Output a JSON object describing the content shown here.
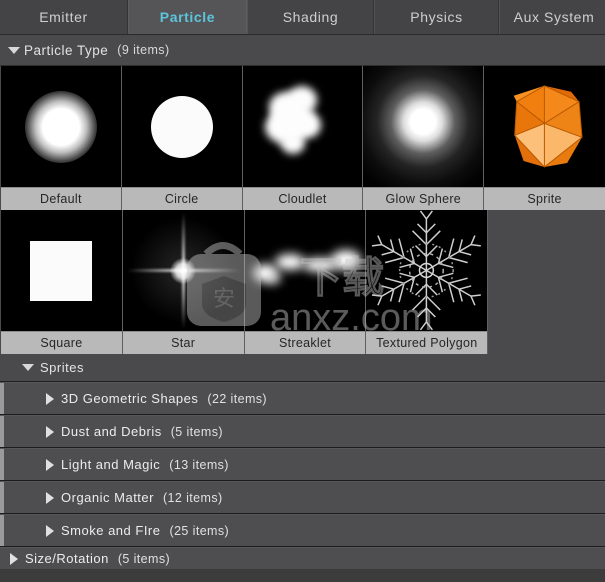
{
  "tabs": [
    {
      "label": "Emitter",
      "active": false
    },
    {
      "label": "Particle",
      "active": true
    },
    {
      "label": "Shading",
      "active": false
    },
    {
      "label": "Physics",
      "active": false
    },
    {
      "label": "Aux System",
      "active": false
    }
  ],
  "particle_type_section": {
    "title": "Particle Type",
    "count": "(9 items)",
    "expanded": true,
    "items": [
      {
        "label": "Default",
        "art": "soft-glow-dot"
      },
      {
        "label": "Circle",
        "art": "hard-circle"
      },
      {
        "label": "Cloudlet",
        "art": "cloud-blob"
      },
      {
        "label": "Glow Sphere",
        "art": "radial-glow"
      },
      {
        "label": "Sprite",
        "art": "orange-icosahedron"
      },
      {
        "label": "Square",
        "art": "white-square"
      },
      {
        "label": "Star",
        "art": "cross-flare-star"
      },
      {
        "label": "Streaklet",
        "art": "streak-blobs"
      },
      {
        "label": "Textured Polygon",
        "art": "snowflake-crystal"
      }
    ]
  },
  "sprites_section": {
    "title": "Sprites",
    "expanded": true,
    "rows": [
      {
        "label": "3D Geometric Shapes",
        "count": "(22 items)",
        "expanded": false
      },
      {
        "label": "Dust and Debris",
        "count": "(5 items)",
        "expanded": false
      },
      {
        "label": "Light and Magic",
        "count": "(13 items)",
        "expanded": false
      },
      {
        "label": "Organic Matter",
        "count": "(12 items)",
        "expanded": false
      },
      {
        "label": "Smoke and FIre",
        "count": "(25 items)",
        "expanded": false
      }
    ]
  },
  "next_section": {
    "label": "Size/Rotation",
    "count": "(5 items)",
    "expanded": false
  },
  "watermark": {
    "text": "anxz.com",
    "badge_char": "安",
    "cjk": "下载"
  },
  "colors": {
    "tab_active_text": "#5cc5db",
    "tab_bar_bg": "#4a4a4d",
    "panel_bg": "#4a4a4c",
    "thumb_bg": "#000000",
    "label_bar_bg": "#b9b9b9",
    "sprite_orange": "#f28212"
  }
}
